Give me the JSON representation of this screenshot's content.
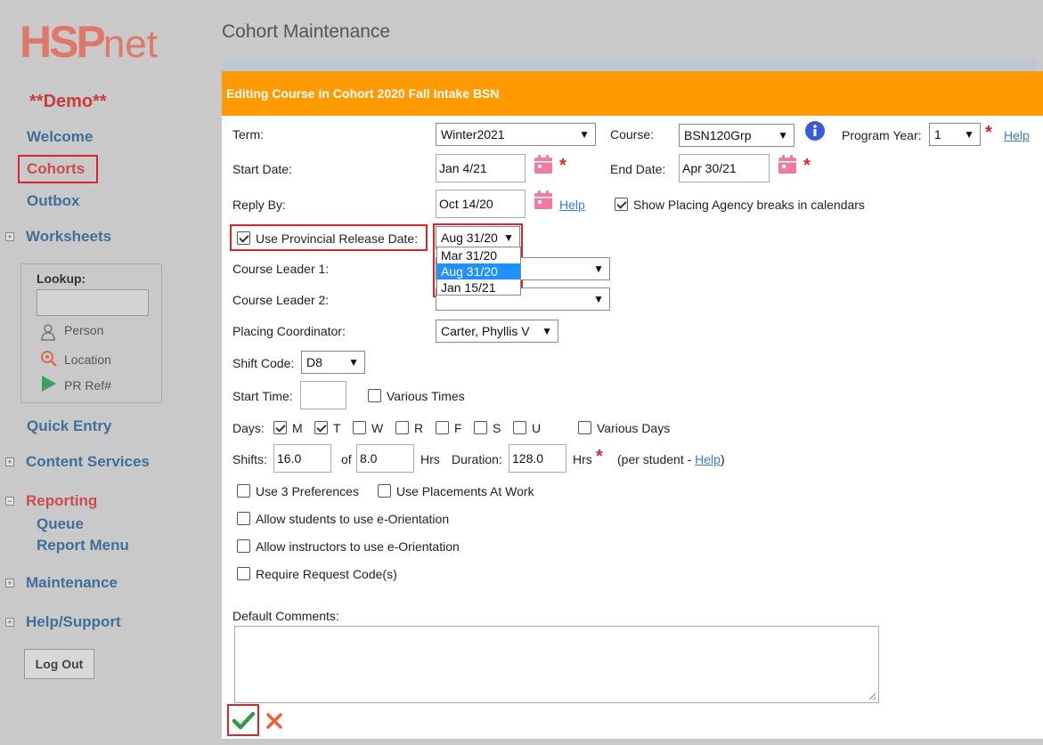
{
  "logo": {
    "part1": "HSP",
    "part2": "net"
  },
  "sidebar": {
    "demo": "**Demo**",
    "welcome": "Welcome",
    "cohorts": "Cohorts",
    "outbox": "Outbox",
    "worksheets": "Worksheets",
    "lookup_label": "Lookup:",
    "lookup_person": "Person",
    "lookup_location": "Location",
    "lookup_prref": "PR Ref#",
    "quick_entry": "Quick Entry",
    "content_services": "Content Services",
    "reporting": "Reporting",
    "queue": "Queue",
    "report_menu": "Report Menu",
    "maintenance": "Maintenance",
    "help_support": "Help/Support",
    "logout": "Log Out"
  },
  "page": {
    "title": "Cohort Maintenance",
    "header": "Editing Course in Cohort 2020 Fall Intake BSN"
  },
  "form": {
    "term_label": "Term:",
    "term_value": "Winter2021",
    "course_label": "Course:",
    "course_value": "BSN120Grp",
    "program_year_label": "Program Year:",
    "program_year_value": "1",
    "help": "Help",
    "start_date_label": "Start Date:",
    "start_date_value": "Jan 4/21",
    "end_date_label": "End Date:",
    "end_date_value": "Apr 30/21",
    "reply_by_label": "Reply By:",
    "reply_by_value": "Oct 14/20",
    "show_breaks_label": "Show Placing Agency breaks in calendars",
    "use_release_label": "Use Provincial Release Date:",
    "release_value": "Aug 31/20",
    "release_options": [
      "Mar 31/20",
      "Aug 31/20",
      "Jan 15/21"
    ],
    "course_leader1_label": "Course Leader 1:",
    "course_leader2_label": "Course Leader 2:",
    "placing_coord_label": "Placing Coordinator:",
    "placing_coord_value": "Carter, Phyllis V",
    "shift_code_label": "Shift Code:",
    "shift_code_value": "D8",
    "start_time_label": "Start Time:",
    "various_times": "Various Times",
    "days_label": "Days:",
    "days": [
      "M",
      "T",
      "W",
      "R",
      "F",
      "S",
      "U"
    ],
    "various_days": "Various Days",
    "shifts_label": "Shifts:",
    "shifts_value": "16.0",
    "of_label": "of",
    "of_value": "8.0",
    "hrs1": "Hrs",
    "duration_label": "Duration:",
    "duration_value": "128.0",
    "hrs2": "Hrs",
    "per_student_pre": "(per student - ",
    "per_student_help": "Help",
    "per_student_post": ")",
    "use3pref": "Use 3 Preferences",
    "use_at_work": "Use Placements At Work",
    "allow_students": "Allow students to use e-Orientation",
    "allow_instructors": "Allow instructors to use e-Orientation",
    "require_request": "Require Request Code(s)",
    "default_comments_label": "Default Comments:"
  },
  "colors": {
    "header": "#ff9a00",
    "accent_red": "#d9252d",
    "link": "#3a7bc8",
    "calendar": "#f07aa0"
  }
}
